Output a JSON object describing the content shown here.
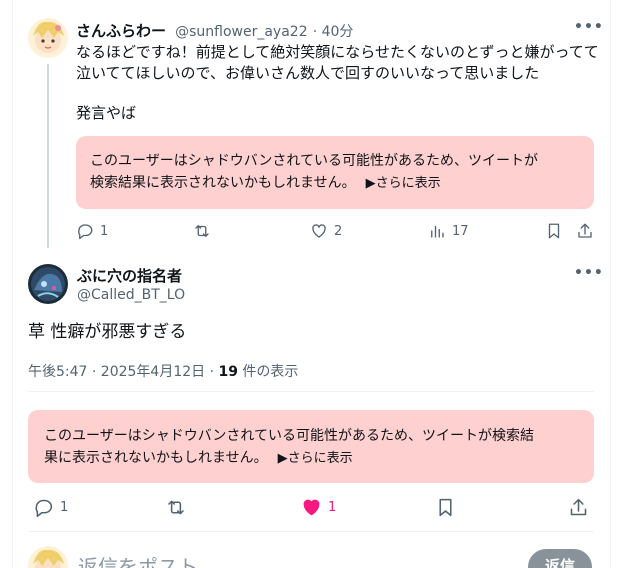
{
  "reply_tweet": {
    "display_name": "さんふらわー",
    "handle": "@sunflower_aya22",
    "time": "· 40分",
    "text_lines": [
      "なるほどですね！前提として絶対笑顔にならせたくないのとずっと嫌がってて",
      "泣いててほしいので、お偉いさん数人で回すのいいなって思いました"
    ],
    "text_extra": "発言やば",
    "warning_lines": [
      "このユーザーはシャドウバンされている可能性があるため、ツイートが",
      "検索結果に表示されないかもしれません。"
    ],
    "warning_link": "▶さらに表示",
    "counts": {
      "replies": "1",
      "retweets": "",
      "likes": "2",
      "views": "17"
    }
  },
  "main_tweet": {
    "display_name": "ぶに穴の指名者",
    "handle": "@Called_BT_LO",
    "text": "草 性癖が邪悪すぎる",
    "meta_time": "午後5:47 · 2025年4月12日 · ",
    "views_count": "19",
    "views_label": " 件の表示",
    "warning_lines": [
      "このユーザーはシャドウバンされている可能性があるため、ツイートが検索結",
      "果に表示されないかもしれません。"
    ],
    "warning_link": "▶さらに表示",
    "counts": {
      "replies": "1",
      "retweets": "",
      "likes": "1"
    }
  },
  "composer": {
    "placeholder": "返信をポスト",
    "button_label": "返信"
  },
  "colors": {
    "like_active": "#f91880",
    "warning_bg": "#ffd0d0",
    "muted": "#536471"
  },
  "icons": [
    "more-icon",
    "reply-icon",
    "retweet-icon",
    "like-icon",
    "views-icon",
    "bookmark-icon",
    "share-icon"
  ]
}
